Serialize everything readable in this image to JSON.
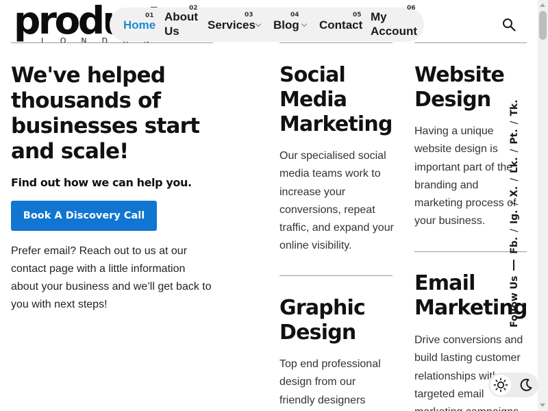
{
  "brand": {
    "logo_text": "product",
    "logo_subtext": "LONDON"
  },
  "nav": {
    "items": [
      {
        "num": "01",
        "label": "Home",
        "active": true
      },
      {
        "num": "02",
        "label": "About Us"
      },
      {
        "num": "03",
        "label": "Services",
        "dropdown": true
      },
      {
        "num": "04",
        "label": "Blog",
        "dropdown": true
      },
      {
        "num": "05",
        "label": "Contact"
      },
      {
        "num": "06",
        "label": "My Account"
      }
    ],
    "search_icon": "search-icon"
  },
  "hero": {
    "title": "We've helped thousands of businesses start and scale!",
    "subtitle": "Find out how we can help you.",
    "cta_label": "Book A Discovery Call",
    "body": "Prefer email? Reach out to us at our contact page with a little information about your business and we’ll get back to you with next steps!"
  },
  "services": [
    {
      "title": "Social Media Marketing",
      "text": "Our specialised social media teams work to increase your conversions, repeat traffic, and expand your online visibility."
    },
    {
      "title": "Website Design",
      "text": "Having a unique website design is important part of the branding and marketing process of your business."
    },
    {
      "title": "Graphic Design",
      "text": "Top end professional design from our friendly designers"
    },
    {
      "title": "Email Marketing",
      "text": "Drive conversions and build lasting customer relationships with targeted email marketing campaigns"
    }
  ],
  "social": {
    "follow_label": "Follow Us",
    "links": [
      "Fb.",
      "Ig.",
      "X.",
      "Lk.",
      "Pt.",
      "Tk."
    ]
  },
  "theme_toggle": {
    "light_icon": "sun-icon",
    "dark_icon": "moon-icon"
  },
  "colors": {
    "accent": "#1176d1",
    "active_nav": "#1a8bd6",
    "text": "#1a1a1a"
  }
}
